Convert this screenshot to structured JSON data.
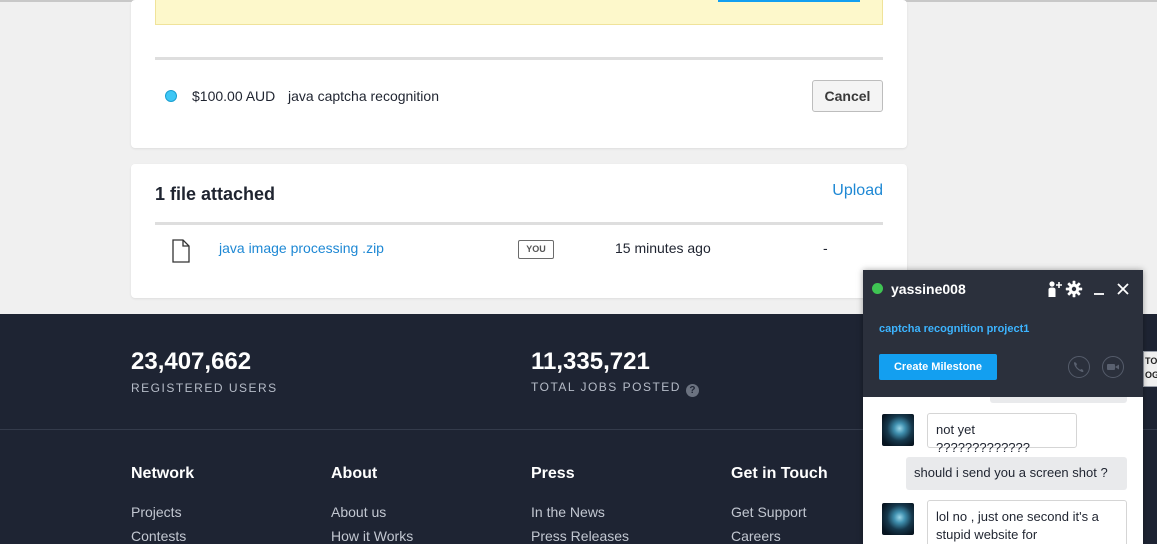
{
  "milestone": {
    "amount": "$100.00 AUD",
    "description": "java captcha recognition",
    "cancel_label": "Cancel",
    "status_color": "#3ec7f5"
  },
  "files": {
    "title": "1 file attached",
    "upload_label": "Upload",
    "items": [
      {
        "name": "java image processing .zip",
        "owner": "YOU",
        "time": "15 minutes ago",
        "extra": "-"
      }
    ]
  },
  "footer": {
    "stats": [
      {
        "value": "23,407,662",
        "label": "REGISTERED USERS"
      },
      {
        "value": "11,335,721",
        "label": "TOTAL JOBS POSTED"
      }
    ],
    "help_glyph": "?",
    "columns": [
      {
        "heading": "Network",
        "links": [
          "Projects",
          "Contests"
        ]
      },
      {
        "heading": "About",
        "links": [
          "About us",
          "How it Works"
        ]
      },
      {
        "heading": "Press",
        "links": [
          "In the News",
          "Press Releases"
        ]
      },
      {
        "heading": "Get in Touch",
        "links": [
          "Get Support",
          "Careers"
        ]
      }
    ],
    "background_color": "#1e2433"
  },
  "chat": {
    "username": "yassine008",
    "project": "captcha recognition project1",
    "milestone_button": "Create Milestone",
    "messages": [
      {
        "from": "them",
        "text": "not yet ?????????????"
      },
      {
        "from": "me",
        "text": "should i send you a screen shot ?"
      },
      {
        "from": "them",
        "text": "lol no , just one second it's a stupid website for"
      }
    ],
    "icons": [
      "add-user-icon",
      "gear-icon",
      "minimize-icon",
      "close-icon",
      "phone-icon",
      "video-icon"
    ],
    "accent_color": "#139ff0"
  },
  "edge": {
    "line1": "TO",
    "line2": "OG"
  }
}
